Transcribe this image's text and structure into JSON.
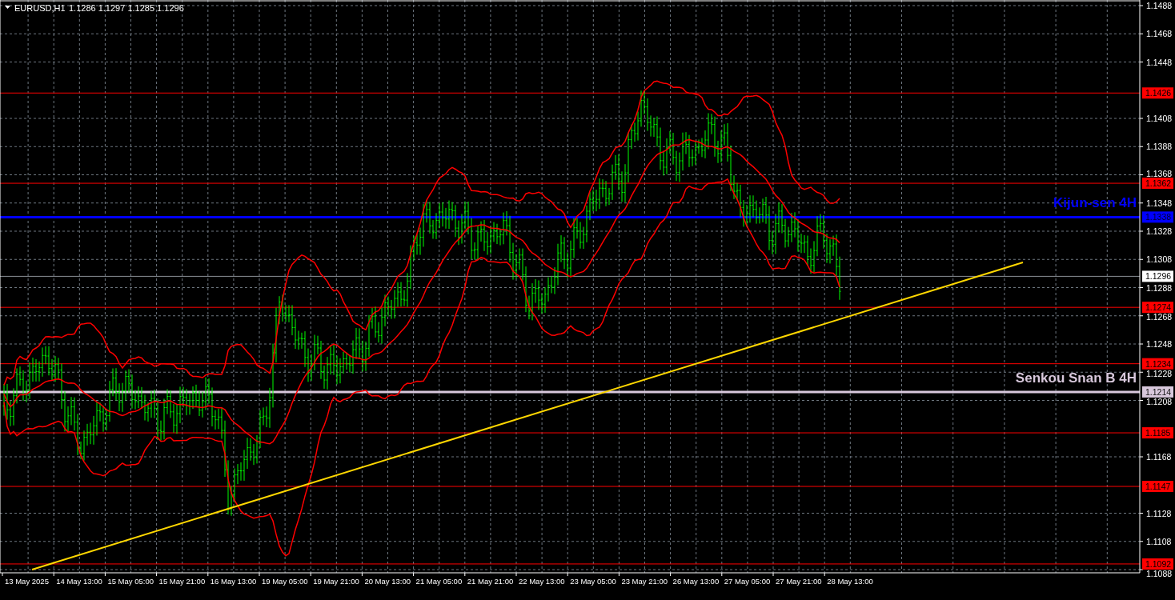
{
  "chart": {
    "symbol": "EURUSD,H1",
    "quote": "1.1286 1.1297 1.1285 1.1296"
  },
  "price_axis": {
    "ticks": [
      "1.1488",
      "1.1468",
      "1.1448",
      "1.1408",
      "1.1388",
      "1.1368",
      "1.1348",
      "1.1328",
      "1.1308",
      "1.1288",
      "1.1268",
      "1.1248",
      "1.1228",
      "1.1208",
      "1.1168",
      "1.1128",
      "1.1108",
      "1.1088"
    ]
  },
  "levels": [
    {
      "kind": "support",
      "label": "1.1426"
    },
    {
      "kind": "support",
      "label": "1.1362"
    },
    {
      "kind": "kijun",
      "label": "1.1338",
      "annotation": "Kijun-sen 4H"
    },
    {
      "kind": "current",
      "label": "1.1296"
    },
    {
      "kind": "support",
      "label": "1.1274"
    },
    {
      "kind": "support",
      "label": "1.1234"
    },
    {
      "kind": "senkou",
      "label": "1.1214",
      "annotation": "Senkou Snan B 4H"
    },
    {
      "kind": "support",
      "label": "1.1185"
    },
    {
      "kind": "support",
      "label": "1.1147"
    },
    {
      "kind": "support",
      "label": "1.1092"
    }
  ],
  "time_axis": {
    "labels": [
      "13 May 2025",
      "14 May 13:00",
      "15 May 05:00",
      "15 May 21:00",
      "16 May 13:00",
      "19 May 05:00",
      "19 May 21:00",
      "20 May 13:00",
      "21 May 05:00",
      "21 May 21:00",
      "22 May 13:00",
      "23 May 05:00",
      "23 May 21:00",
      "26 May 13:00",
      "27 May 05:00",
      "27 May 21:00",
      "28 May 13:00"
    ]
  }
}
